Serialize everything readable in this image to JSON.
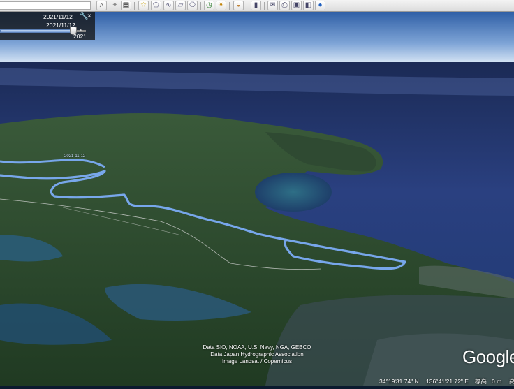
{
  "toolbar": {
    "buttons": [
      "search-icon",
      "sun-icon",
      "placemark-icon",
      "polygon-icon",
      "path-icon",
      "overlay-icon",
      "tour-icon",
      "historical-imagery-icon",
      "sunlight-icon",
      "planet-icon",
      "ruler-icon",
      "email-icon",
      "print-icon",
      "save-image-icon",
      "maps-icon",
      "earth-icon"
    ]
  },
  "time_slider": {
    "start_date": "2021/11/12",
    "current_date": "2021/11/12",
    "year_label": "2021",
    "position_fraction": 0.85
  },
  "map": {
    "track_label": "2021-11-12"
  },
  "attribution": {
    "line1": "Data SIO, NOAA, U.S. Navy, NGA, GEBCO",
    "line2": "Data Japan Hydrographic Association",
    "line3": "Image Landsat / Copernicus"
  },
  "logo": "Google",
  "status": {
    "lat": "34°19'31.74\" N",
    "lon": "136°41'21.72\" E",
    "elev_label": "標高",
    "elev_value": "0 m",
    "extra": "高"
  }
}
